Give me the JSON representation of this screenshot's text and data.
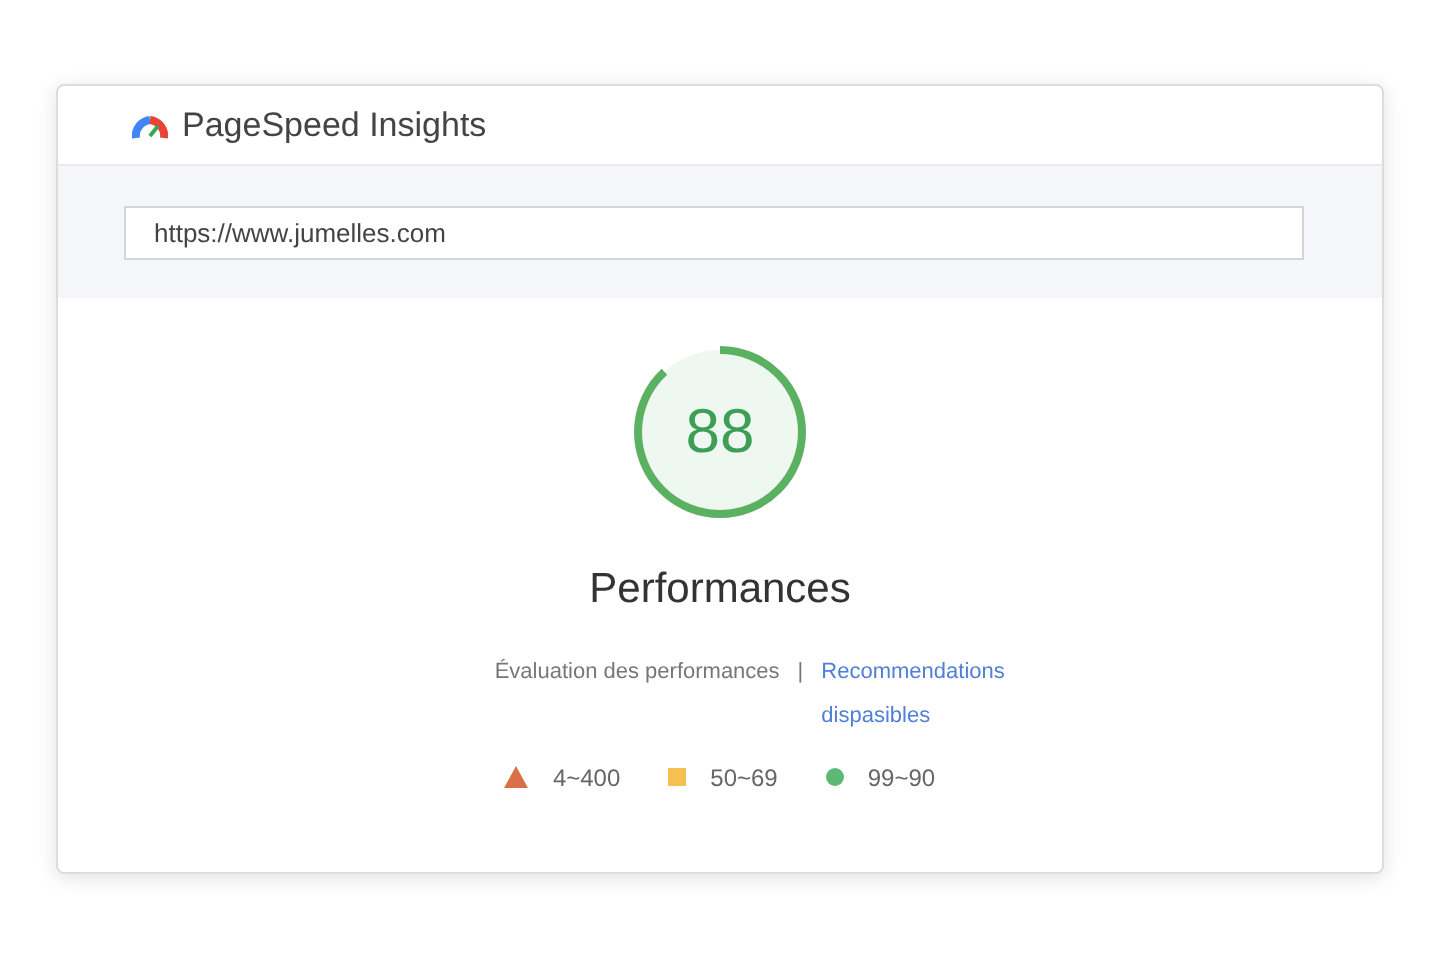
{
  "header": {
    "title": "PageSpeed Insights"
  },
  "search": {
    "value": "https://www.jumelles.com"
  },
  "score": {
    "value": "88",
    "level": 0.88,
    "label": "Performances"
  },
  "links": {
    "description": "Évaluation des performances",
    "separator": "|",
    "recommendations": "Recommendations dispasibles"
  },
  "legend": [
    {
      "kind": "triangle",
      "color": "#d9704a",
      "label": "4~400"
    },
    {
      "kind": "square",
      "color": "#f5c04f",
      "label": "50~69"
    },
    {
      "kind": "circle",
      "color": "#5bb974",
      "label": "99~90"
    }
  ]
}
